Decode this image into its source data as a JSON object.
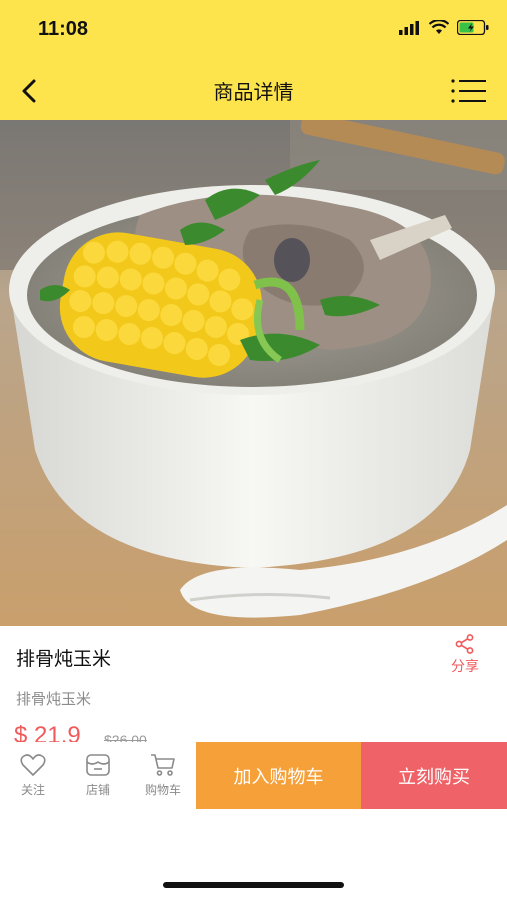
{
  "status": {
    "time": "11:08"
  },
  "nav": {
    "title": "商品详情"
  },
  "product": {
    "name": "排骨炖玉米",
    "subname": "排骨炖玉米",
    "price": "$ 21.9",
    "original_price": "$26.00"
  },
  "actions": {
    "share_label": "分享",
    "follow_label": "关注",
    "shop_label": "店铺",
    "cart_label": "购物车",
    "add_to_cart_label": "加入购物车",
    "buy_now_label": "立刻购买"
  },
  "colors": {
    "header_yellow": "#fde34c",
    "price_red": "#ef5a5a",
    "cart_orange": "#f6a03a",
    "buy_red": "#ef6267"
  },
  "icons": [
    "back-icon",
    "menu-icon",
    "share-icon",
    "heart-icon",
    "store-icon",
    "cart-icon"
  ]
}
